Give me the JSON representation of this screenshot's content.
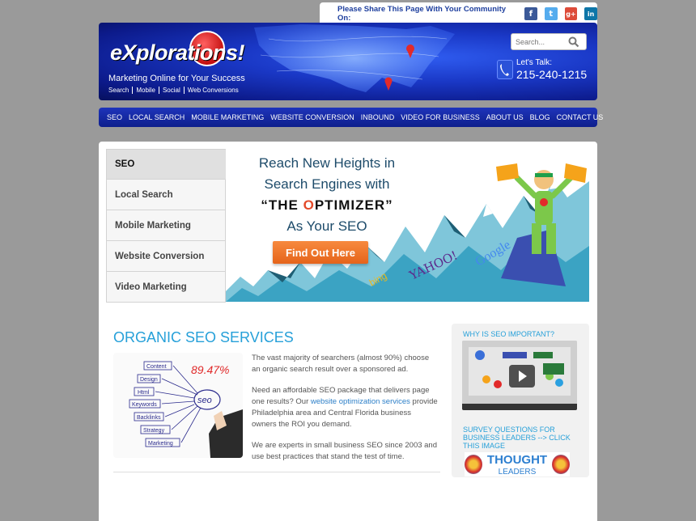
{
  "share": {
    "label": "Please Share This Page With Your Community On:",
    "icons": [
      "facebook-icon",
      "twitter-icon",
      "google-plus-icon",
      "linkedin-icon"
    ],
    "icon_glyphs": [
      "f",
      "t",
      "g+",
      "in"
    ]
  },
  "header": {
    "logo_text": "eXplorations!",
    "tagline": "Marketing Online for Your Success",
    "sublinks": [
      "Search",
      "Mobile",
      "Social",
      "Web Conversions"
    ],
    "search_placeholder": "Search...",
    "lets_talk": "Let's Talk:",
    "phone": "215-240-1215"
  },
  "nav": {
    "items": [
      "SEO",
      "LOCAL SEARCH",
      "MOBILE MARKETING",
      "WEBSITE CONVERSION",
      "INBOUND",
      "VIDEO FOR BUSINESS",
      "ABOUT US",
      "BLOG",
      "CONTACT US"
    ]
  },
  "tabs": {
    "items": [
      "SEO",
      "Local Search",
      "Mobile Marketing",
      "Website Conversion",
      "Video Marketing"
    ]
  },
  "banner": {
    "line1": "Reach New Heights in",
    "line2": "Search Engines with",
    "quote_open": "“THE ",
    "o_letter": "O",
    "quote_rest": "PTIMIZER”",
    "line4": "As Your SEO",
    "button": "Find Out Here",
    "engines": [
      "bing",
      "YAHOO!",
      "Google"
    ]
  },
  "content": {
    "heading": "ORGANIC SEO SERVICES",
    "p1": "The vast majority of searchers (almost 90%) choose an organic search result over a sponsored ad.",
    "p2_a": "Need an affordable SEO package that delivers page one results? Our ",
    "p2_link": "website optimization services",
    "p2_b": " provide Philadelphia area and Central Florida business owners the ROI you demand.",
    "p3": "We are experts in small business SEO since 2003 and use best practices that stand the test of time.",
    "seo_image": {
      "percent": "89.47%",
      "center": "seo",
      "words": [
        "Content",
        "Design",
        "Html",
        "Keywords",
        "Backlinks",
        "Strategy",
        "Marketing"
      ]
    }
  },
  "sidebar": {
    "title1": "WHY IS SEO IMPORTANT?",
    "title2": "SURVEY QUESTIONS FOR BUSINESS LEADERS --> CLICK THIS IMAGE",
    "thought_1": "THOUGHT",
    "thought_2": "LEADERS"
  }
}
